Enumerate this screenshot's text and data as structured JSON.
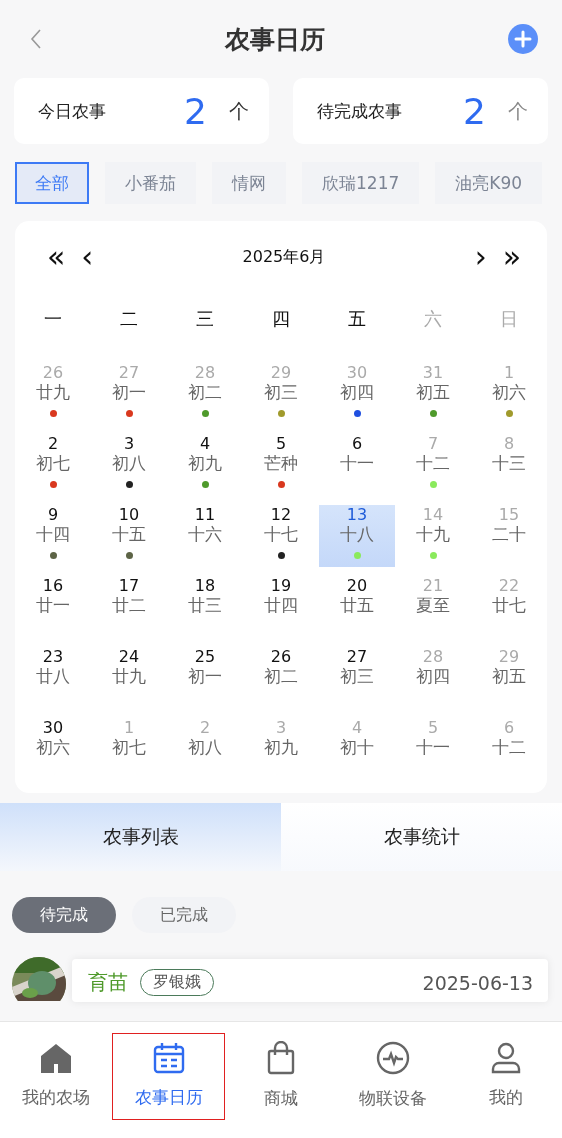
{
  "header": {
    "title": "农事日历"
  },
  "stats": [
    {
      "label": "今日农事",
      "value": "2",
      "unit": "个"
    },
    {
      "label": "待完成农事",
      "value": "2",
      "unit": "个"
    }
  ],
  "filters": [
    {
      "label": "全部",
      "selected": true
    },
    {
      "label": "小番茄",
      "selected": false
    },
    {
      "label": "情网",
      "selected": false
    },
    {
      "label": "欣瑞1217",
      "selected": false
    },
    {
      "label": "油亮K90",
      "selected": false
    }
  ],
  "calendar": {
    "prev_year": "«",
    "prev_month": "‹",
    "month": "2025年6月",
    "next_month": "›",
    "next_year": "»",
    "weekdays": [
      {
        "label": "一",
        "weekend": false
      },
      {
        "label": "二",
        "weekend": false
      },
      {
        "label": "三",
        "weekend": false
      },
      {
        "label": "四",
        "weekend": false
      },
      {
        "label": "五",
        "weekend": false
      },
      {
        "label": "六",
        "weekend": true
      },
      {
        "label": "日",
        "weekend": true
      }
    ],
    "days": [
      {
        "day": "26",
        "lunar": "廿九",
        "muted": true,
        "selected": false,
        "color": "#d9381e"
      },
      {
        "day": "27",
        "lunar": "初一",
        "muted": true,
        "selected": false,
        "color": "#d9381e"
      },
      {
        "day": "28",
        "lunar": "初二",
        "muted": true,
        "selected": false,
        "color": "#4f9a2b"
      },
      {
        "day": "29",
        "lunar": "初三",
        "muted": true,
        "selected": false,
        "color": "#a09a2c"
      },
      {
        "day": "30",
        "lunar": "初四",
        "muted": true,
        "selected": false,
        "color": "#1f4fe0"
      },
      {
        "day": "31",
        "lunar": "初五",
        "muted": true,
        "selected": false,
        "color": "#4f9a2b"
      },
      {
        "day": "1",
        "lunar": "初六",
        "muted": true,
        "selected": false,
        "color": "#a09a2c"
      },
      {
        "day": "2",
        "lunar": "初七",
        "muted": false,
        "selected": false,
        "color": "#d9381e"
      },
      {
        "day": "3",
        "lunar": "初八",
        "muted": false,
        "selected": false,
        "color": "#222222"
      },
      {
        "day": "4",
        "lunar": "初九",
        "muted": false,
        "selected": false,
        "color": "#4f9a2b"
      },
      {
        "day": "5",
        "lunar": "芒种",
        "muted": false,
        "selected": false,
        "color": "#d9381e"
      },
      {
        "day": "6",
        "lunar": "十一",
        "muted": false,
        "selected": false
      },
      {
        "day": "7",
        "lunar": "十二",
        "muted": true,
        "selected": false,
        "color": "#8aea5c"
      },
      {
        "day": "8",
        "lunar": "十三",
        "muted": true,
        "selected": false
      },
      {
        "day": "9",
        "lunar": "十四",
        "muted": false,
        "selected": false,
        "color": "#5d6446"
      },
      {
        "day": "10",
        "lunar": "十五",
        "muted": false,
        "selected": false,
        "color": "#5d6446"
      },
      {
        "day": "11",
        "lunar": "十六",
        "muted": false,
        "selected": false
      },
      {
        "day": "12",
        "lunar": "十七",
        "muted": false,
        "selected": false,
        "color": "#222222"
      },
      {
        "day": "13",
        "lunar": "十八",
        "muted": false,
        "selected": true,
        "color": "#8aea5c"
      },
      {
        "day": "14",
        "lunar": "十九",
        "muted": true,
        "selected": false,
        "color": "#8aea5c"
      },
      {
        "day": "15",
        "lunar": "二十",
        "muted": true,
        "selected": false
      },
      {
        "day": "16",
        "lunar": "廿一",
        "muted": false,
        "selected": false
      },
      {
        "day": "17",
        "lunar": "廿二",
        "muted": false,
        "selected": false
      },
      {
        "day": "18",
        "lunar": "廿三",
        "muted": false,
        "selected": false
      },
      {
        "day": "19",
        "lunar": "廿四",
        "muted": false,
        "selected": false
      },
      {
        "day": "20",
        "lunar": "廿五",
        "muted": false,
        "selected": false
      },
      {
        "day": "21",
        "lunar": "夏至",
        "muted": true,
        "selected": false
      },
      {
        "day": "22",
        "lunar": "廿七",
        "muted": true,
        "selected": false
      },
      {
        "day": "23",
        "lunar": "廿八",
        "muted": false,
        "selected": false
      },
      {
        "day": "24",
        "lunar": "廿九",
        "muted": false,
        "selected": false
      },
      {
        "day": "25",
        "lunar": "初一",
        "muted": false,
        "selected": false
      },
      {
        "day": "26",
        "lunar": "初二",
        "muted": false,
        "selected": false
      },
      {
        "day": "27",
        "lunar": "初三",
        "muted": false,
        "selected": false
      },
      {
        "day": "28",
        "lunar": "初四",
        "muted": true,
        "selected": false
      },
      {
        "day": "29",
        "lunar": "初五",
        "muted": true,
        "selected": false
      },
      {
        "day": "30",
        "lunar": "初六",
        "muted": false,
        "selected": false
      },
      {
        "day": "1",
        "lunar": "初七",
        "muted": true,
        "selected": false
      },
      {
        "day": "2",
        "lunar": "初八",
        "muted": true,
        "selected": false
      },
      {
        "day": "3",
        "lunar": "初九",
        "muted": true,
        "selected": false
      },
      {
        "day": "4",
        "lunar": "初十",
        "muted": true,
        "selected": false
      },
      {
        "day": "5",
        "lunar": "十一",
        "muted": true,
        "selected": false
      },
      {
        "day": "6",
        "lunar": "十二",
        "muted": true,
        "selected": false
      }
    ]
  },
  "views": [
    {
      "label": "农事列表",
      "selected": true
    },
    {
      "label": "农事统计",
      "selected": false
    }
  ],
  "status_filters": [
    {
      "label": "待完成",
      "selected": true
    },
    {
      "label": "已完成",
      "selected": false
    }
  ],
  "tasks": [
    {
      "kind": "picture",
      "title": "育苗",
      "person": "罗银娥",
      "date": "2025-06-13"
    }
  ],
  "tab_bar": [
    {
      "label": "我的农场",
      "selected": false
    },
    {
      "label": "农事日历",
      "selected": true
    },
    {
      "label": "商城",
      "selected": false
    },
    {
      "label": "物联设备",
      "selected": false
    },
    {
      "label": "我的",
      "selected": false
    }
  ]
}
